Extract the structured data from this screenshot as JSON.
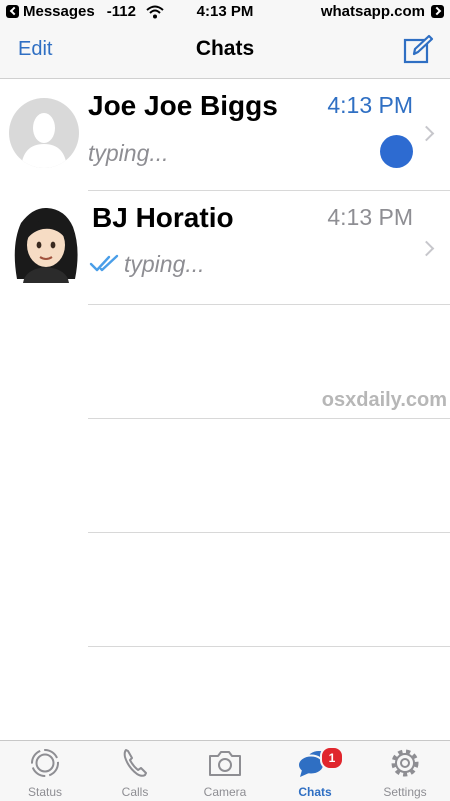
{
  "status_bar": {
    "back_app": "Messages",
    "signal": "-112",
    "time": "4:13 PM",
    "site": "whatsapp.com"
  },
  "nav": {
    "edit_label": "Edit",
    "title": "Chats",
    "compose_icon": "compose-icon"
  },
  "chats": [
    {
      "name": "Joe Joe Biggs",
      "time": "4:13 PM",
      "preview": "typing...",
      "avatar_icon": "default-avatar-icon",
      "time_color": "#2f6fc3",
      "has_unread_dot": true
    },
    {
      "name": "BJ Horatio",
      "time": "4:13 PM",
      "preview": "typing...",
      "avatar_icon": "woman-emoji-avatar",
      "time_color": "#8e8e93",
      "read_receipt_icon": "double-check-icon"
    }
  ],
  "watermark": "osxdaily.com",
  "tab_bar": {
    "tabs": [
      {
        "label": "Status",
        "icon": "status-icon"
      },
      {
        "label": "Calls",
        "icon": "phone-icon"
      },
      {
        "label": "Camera",
        "icon": "camera-icon"
      },
      {
        "label": "Chats",
        "icon": "chats-icon",
        "active": true,
        "badge": "1"
      },
      {
        "label": "Settings",
        "icon": "gear-icon"
      }
    ]
  },
  "colors": {
    "accent": "#2f6fc3",
    "unread_dot": "#2d6bd1",
    "badge": "#e0262d"
  }
}
